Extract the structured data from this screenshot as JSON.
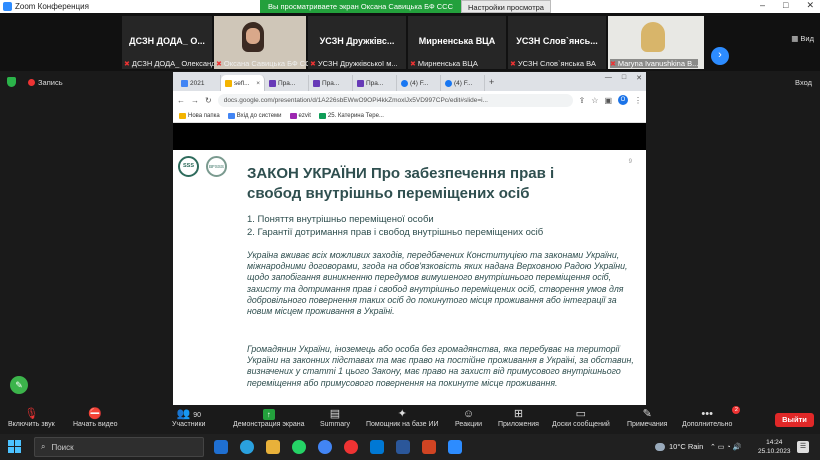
{
  "window": {
    "title": "Zoom Конференция"
  },
  "banner": {
    "message": "Вы просматриваете экран Оксана Савицька БФ ССС",
    "options": "Настройки просмотра"
  },
  "window_controls": {
    "minimize": "–",
    "maximize": "□",
    "close": "✕"
  },
  "participants": [
    {
      "big": "ДСЗН ДОДА_ О...",
      "label": "ДСЗН ДОДА_ Олександр"
    },
    {
      "big": "",
      "label": "Оксана Савицька БФ ССС"
    },
    {
      "big": "УСЗН Дружківс...",
      "label": "УСЗН Дружківської м..."
    },
    {
      "big": "Мирненська ВЦА",
      "label": "Мирненська ВЦА"
    },
    {
      "big": "УСЗН Слов`янсь...",
      "label": "УСЗН Слов`янська ВА"
    },
    {
      "big": "",
      "label": "Maryna Ivanushkina B..."
    }
  ],
  "view_label": "Вид",
  "status": {
    "recording": "Запись",
    "exit_fullscreen": "Вход"
  },
  "browser": {
    "tabs": [
      {
        "label": "2021",
        "color": "#4285f4"
      },
      {
        "label": "sefl...",
        "color": "#f4b400"
      },
      {
        "label": "Пра...",
        "color": "#673ab7"
      },
      {
        "label": "Пра...",
        "color": "#673ab7"
      },
      {
        "label": "Пра...",
        "color": "#673ab7"
      },
      {
        "label": "(4) F...",
        "color": "#1877f2"
      },
      {
        "label": "(4) F...",
        "color": "#1877f2"
      }
    ],
    "url": "docs.google.com/presentation/d/1A226sbEWwO9OPi4kkZmoxlJx5VD997CPc/edit#slide=i...",
    "profile": "O",
    "bookmarks": [
      {
        "label": "Нова папка",
        "icon": "folder"
      },
      {
        "label": "Вхід до системи",
        "icon": "site"
      },
      {
        "label": "ezvit",
        "icon": "site"
      },
      {
        "label": "25. Катерина Тере...",
        "icon": "site"
      }
    ]
  },
  "slide": {
    "logo1": "SSS",
    "logo2": "BFSSS",
    "page": "9",
    "title": "ЗАКОН УКРАЇНИ Про забезпечення прав і свобод внутрішньо переміщених осіб",
    "points": [
      "1. Поняття внутрішньо переміщеної особи",
      "2. Гарантії дотримання прав і свобод внутрішньо переміщених осіб"
    ],
    "paragraph1": "Україна вживає всіх можливих заходів, передбачених Конституцією та законами України, міжнародними договорами, згода на обов'язковість яких надана Верховною Радою України, щодо запобігання виникненню передумов вимушеного внутрішнього переміщення осіб, захисту та дотримання прав і свобод внутрішньо переміщених осіб, створення умов для добровільного повернення таких осіб до покинутого місця проживання або інтеграції за новим місцем проживання в Україні.",
    "paragraph2": "Громадянин України, іноземець або особа без громадянства, яка перебуває на території України на законних підставах та має право на постійне проживання в Україні, за обставин, визначених у статті 1 цього Закону, має право на захист від примусового внутрішнього переміщення або примусового повернення на покинуте місце проживання."
  },
  "toolbar": {
    "mute": "Включить звук",
    "video": "Начать видео",
    "participants": "Участники",
    "participants_count": "90",
    "share": "Демонстрация экрана",
    "summary": "Summary",
    "ai": "Помощник на базе ИИ",
    "reactions": "Реакции",
    "apps": "Приложения",
    "whiteboards": "Доски сообщений",
    "notes": "Примечания",
    "more": "Дополнительно",
    "more_badge": "2",
    "leave": "Выйти"
  },
  "taskbar": {
    "search": "Поиск",
    "weather": "10°C  Rain",
    "time": "14:24",
    "date": "25.10.2023"
  }
}
